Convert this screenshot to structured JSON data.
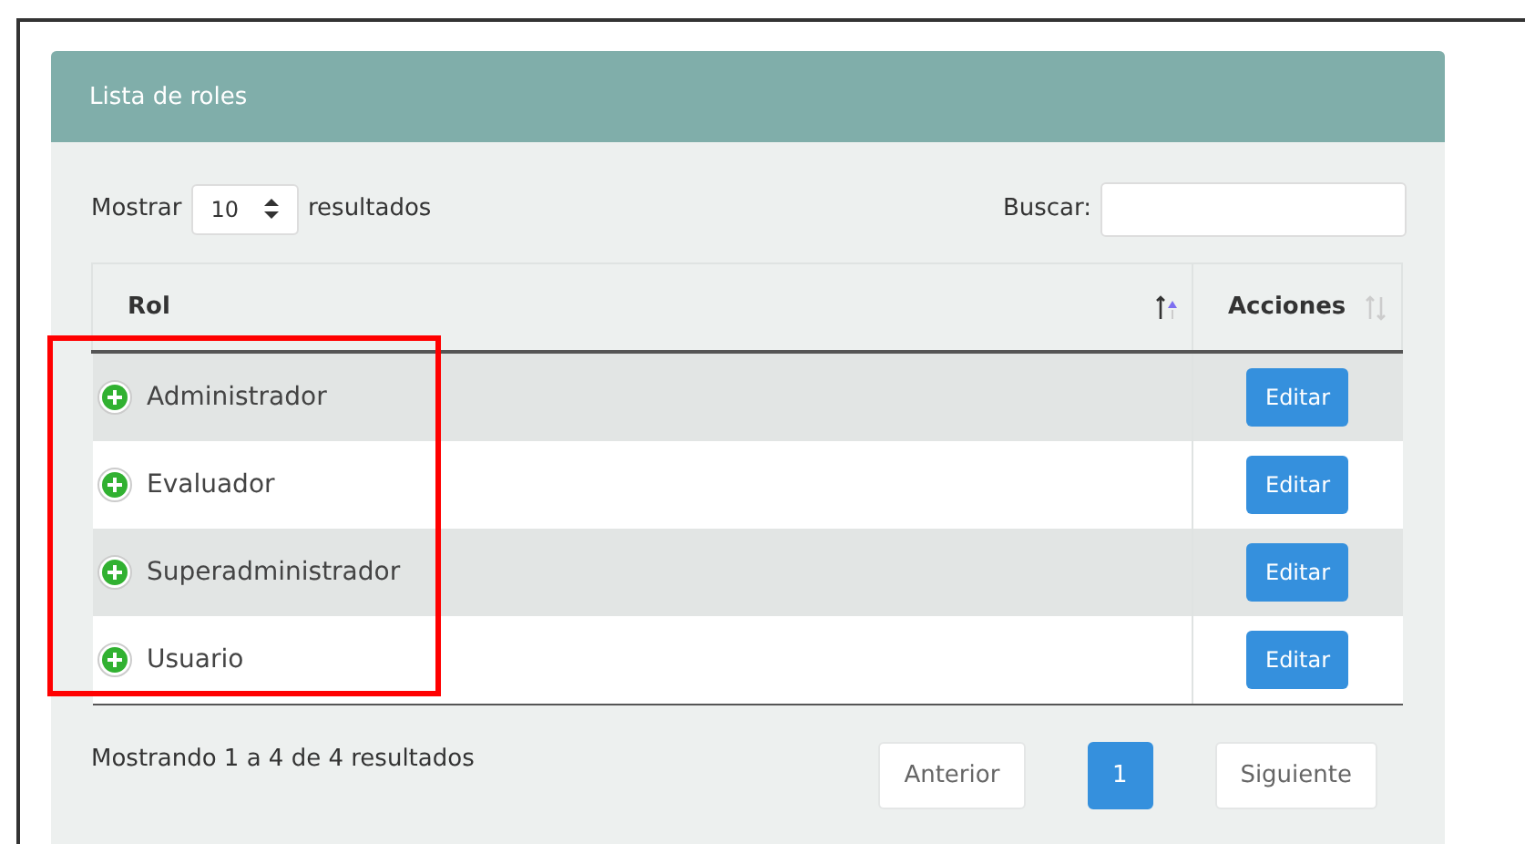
{
  "panel": {
    "title": "Lista de roles"
  },
  "length": {
    "label_before": "Mostrar",
    "value": "10",
    "label_after": "resultados"
  },
  "search": {
    "label": "Buscar:"
  },
  "table": {
    "columns": [
      {
        "label": "Rol",
        "sorted": true
      },
      {
        "label": "Acciones",
        "sorted": false
      }
    ],
    "rows": [
      {
        "rol": "Administrador",
        "action": "Editar"
      },
      {
        "rol": "Evaluador",
        "action": "Editar"
      },
      {
        "rol": "Superadministrador",
        "action": "Editar"
      },
      {
        "rol": "Usuario",
        "action": "Editar"
      }
    ]
  },
  "info": "Mostrando 1 a 4 de 4 resultados",
  "pagination": [
    {
      "label": "Anterior",
      "kind": "nav",
      "selected": false
    },
    {
      "label": "1",
      "kind": "page",
      "selected": true
    },
    {
      "label": "Siguiente",
      "kind": "nav",
      "selected": false
    }
  ]
}
